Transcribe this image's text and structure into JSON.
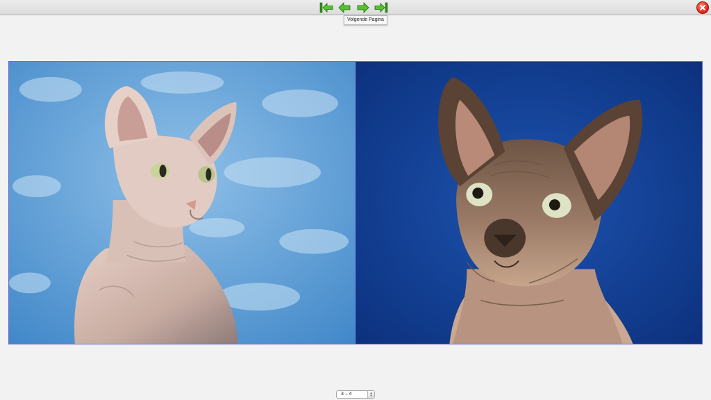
{
  "toolbar": {
    "buttons": [
      {
        "name": "first-page",
        "icon": "first-page-icon"
      },
      {
        "name": "previous-page",
        "icon": "arrow-left-icon"
      },
      {
        "name": "next-page",
        "icon": "arrow-right-icon"
      },
      {
        "name": "last-page",
        "icon": "last-page-icon"
      }
    ],
    "accent_color": "#3fae1c",
    "close_icon": "close-icon",
    "close_color": "#e8281a"
  },
  "tooltip": {
    "text": "Volgende Pagina"
  },
  "spread": {
    "left_page": {
      "subject": "sphynx-cat-light-blue-cloud-background"
    },
    "right_page": {
      "subject": "sphynx-cat-dark-blue-background"
    }
  },
  "pager": {
    "value": "3 – 4"
  }
}
